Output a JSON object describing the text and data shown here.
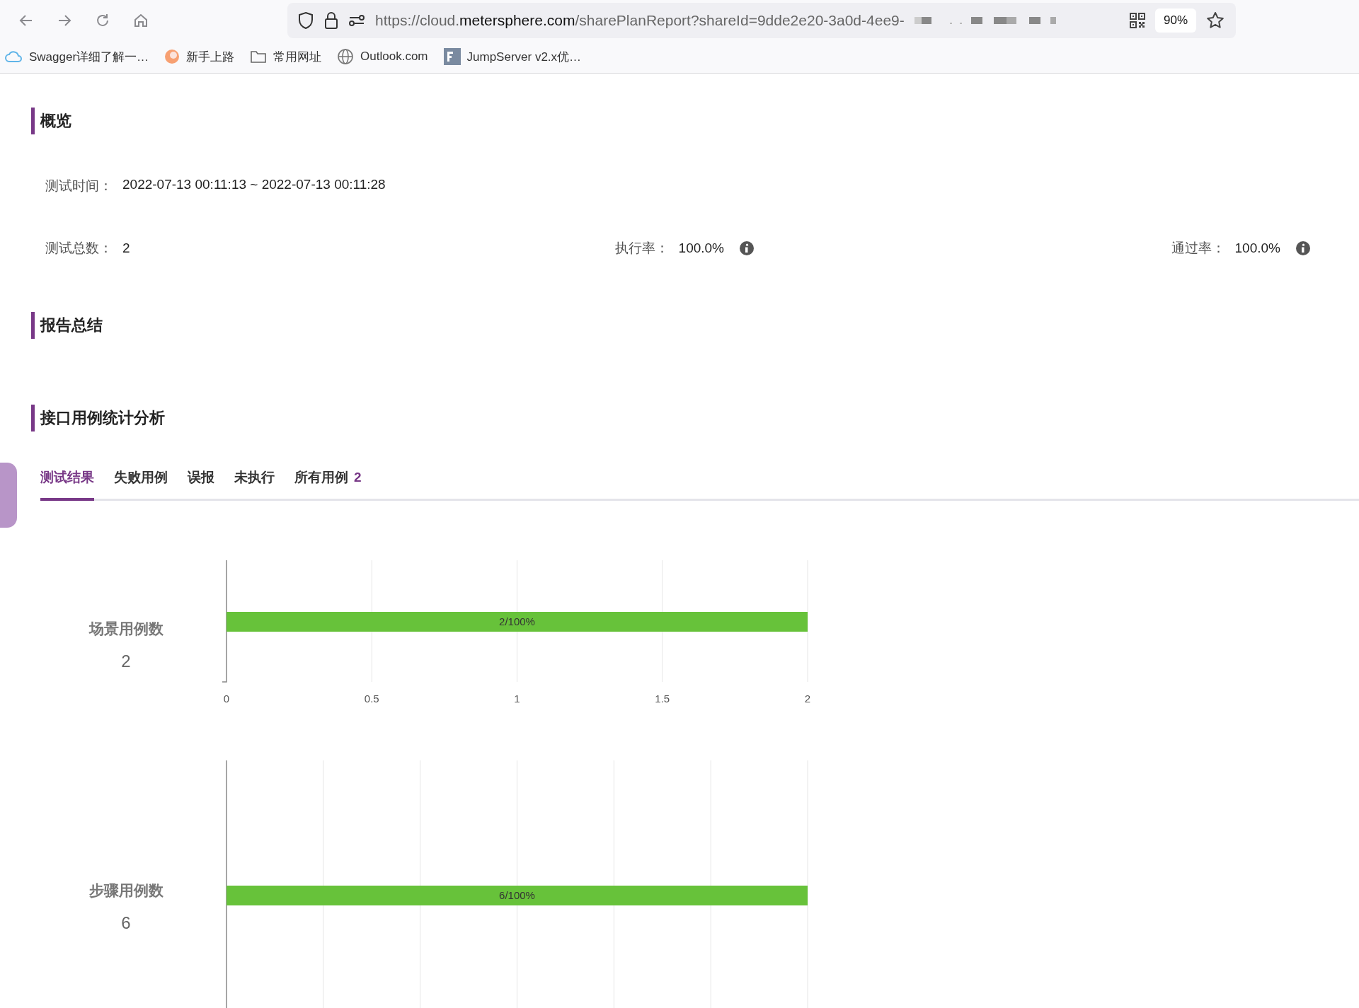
{
  "browser": {
    "url_host": "https://cloud.",
    "url_domain": "metersphere.com",
    "url_path": "/sharePlanReport?shareId=9dde2e20-3a0d-4ee9-",
    "zoom": "90%",
    "bookmarks": [
      {
        "kind": "cloud",
        "label": "Swagger详细了解一…"
      },
      {
        "kind": "orb",
        "label": "新手上路"
      },
      {
        "kind": "folder",
        "label": "常用网址"
      },
      {
        "kind": "globe",
        "label": "Outlook.com"
      },
      {
        "kind": "tile",
        "label": "JumpServer v2.x优…"
      }
    ]
  },
  "overview": {
    "title": "概览",
    "test_time": {
      "label": "测试时间：",
      "value": "2022-07-13 00:11:13 ~ 2022-07-13 00:11:28"
    },
    "stats": [
      {
        "label": "测试总数：",
        "value": "2",
        "info": false
      },
      {
        "label": "执行率：",
        "value": "100.0%",
        "info": true
      },
      {
        "label": "通过率：",
        "value": "100.0%",
        "info": true
      }
    ]
  },
  "summary": {
    "title": "报告总结"
  },
  "analysis": {
    "title": "接口用例统计分析",
    "tabs": [
      {
        "label": "测试结果",
        "selected": true
      },
      {
        "label": "失败用例",
        "selected": false
      },
      {
        "label": "误报",
        "selected": false
      },
      {
        "label": "未执行",
        "selected": false
      },
      {
        "label": "所有用例",
        "count": "2",
        "selected": false
      }
    ],
    "panels": [
      {
        "label": "场景用例数",
        "count": "2",
        "chart_data": {
          "type": "bar",
          "orientation": "horizontal",
          "categories": [
            null
          ],
          "values": [
            2
          ],
          "xlim": [
            0,
            2
          ],
          "xticks": [
            0,
            0.5,
            1,
            1.5,
            2
          ],
          "grid": true,
          "value_labels": [
            "2/100%"
          ],
          "color": "#67c23a"
        }
      },
      {
        "label": "步骤用例数",
        "count": "6",
        "bar_label": "6/100%"
      }
    ]
  }
}
